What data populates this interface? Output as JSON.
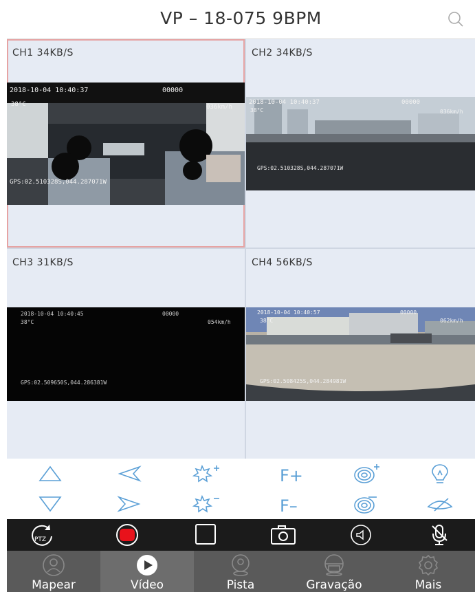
{
  "header": {
    "title": "VP – 18-075 9BPM"
  },
  "channels": [
    {
      "label": "CH1 34KB/S",
      "osd_time": "2018-10-04 10:40:37",
      "osd_code": "00000",
      "osd_temp": "38°C",
      "osd_speed": "036km/h",
      "osd_gps": "GPS:02.510328S,044.287071W"
    },
    {
      "label": "CH2 34KB/S",
      "osd_time": "2018-10-04 10:40:37",
      "osd_code": "00000",
      "osd_temp": "38°C",
      "osd_speed": "036km/h",
      "osd_gps": "GPS:02.510328S,044.287071W"
    },
    {
      "label": "CH3 31KB/S",
      "osd_time": "2018-10-04 10:40:45",
      "osd_code": "00000",
      "osd_temp": "38°C",
      "osd_speed": "054km/h",
      "osd_gps": "GPS:02.509650S,044.286381W"
    },
    {
      "label": "CH4 56KB/S",
      "osd_time": "2018-10-04 10:40:57",
      "osd_code": "00000",
      "osd_temp": "38°C",
      "osd_speed": "062km/h",
      "osd_gps": "GPS:02.508425S,044.284981W"
    }
  ],
  "ptz_controls": [
    "tilt-up",
    "pan-left",
    "zoom-in",
    "focus-plus",
    "iris-plus",
    "light",
    "tilt-down",
    "pan-right",
    "zoom-out",
    "focus-minus",
    "iris-minus",
    "wiper"
  ],
  "ptz_text": {
    "focus_plus": "F+",
    "focus_minus": "F–"
  },
  "toolbar": [
    "ptz",
    "record",
    "fullscreen",
    "snapshot",
    "speaker",
    "microphone"
  ],
  "toolbar_text": {
    "ptz": "PTZ"
  },
  "nav": [
    {
      "label": "Mapear",
      "icon": "map-person-icon"
    },
    {
      "label": "Vídeo",
      "icon": "play-icon"
    },
    {
      "label": "Pista",
      "icon": "track-icon"
    },
    {
      "label": "Gravação",
      "icon": "recording-icon"
    },
    {
      "label": "Mais",
      "icon": "gear-icon"
    }
  ],
  "colors": {
    "accent": "#5a9fd6",
    "record": "#e8121b",
    "toolbar_bg": "#1b1b1b",
    "nav_bg": "#5a5a5a"
  }
}
